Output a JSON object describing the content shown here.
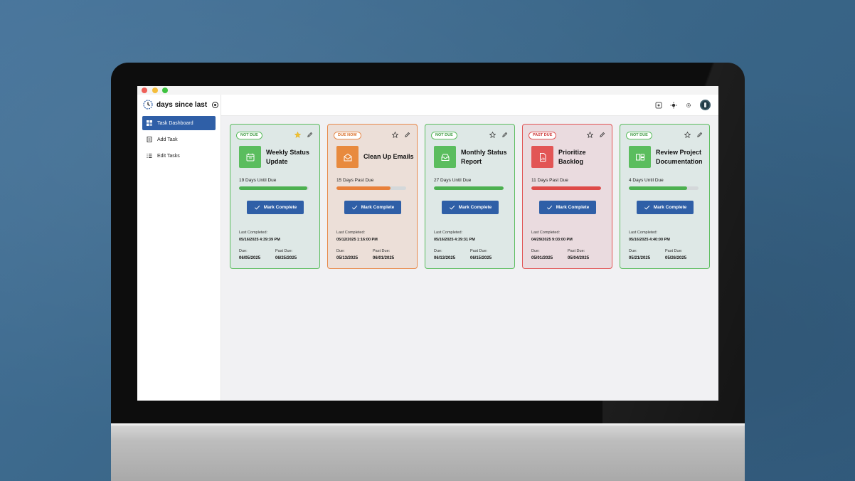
{
  "app": {
    "title": "days since last"
  },
  "sidebar": {
    "items": [
      {
        "label": "Task Dashboard",
        "icon": "dashboard-icon",
        "active": true
      },
      {
        "label": "Add Task",
        "icon": "add-task-icon",
        "active": false
      },
      {
        "label": "Edit Tasks",
        "icon": "list-icon",
        "active": false
      }
    ]
  },
  "topbar": {
    "icons": [
      "grid-icon",
      "sun-icon",
      "settings-icon",
      "avatar"
    ]
  },
  "colors": {
    "primary": "#2f5fa7",
    "not_due": "#5bbd5e",
    "due_now": "#e88a4b",
    "past_due": "#e25555"
  },
  "mark_label": "Mark Complete",
  "labels": {
    "last_completed": "Last Completed:",
    "due": "Due:",
    "past_due": "Past Due:"
  },
  "tasks": [
    {
      "badge": "NOT DUE",
      "status_class": "ok",
      "starred": true,
      "icon": "calendar-icon",
      "title": "Weekly Status Update",
      "status_text": "19 Days Until Due",
      "progress": 0.98,
      "last_completed": "05/16/2025 4:39:39 PM",
      "due": "06/05/2025",
      "past_due": "06/25/2025"
    },
    {
      "badge": "DUE NOW",
      "status_class": "now",
      "starred": false,
      "icon": "envelope-icon",
      "title": "Clean Up Emails",
      "status_text": "15 Days Past Due",
      "progress": 0.78,
      "last_completed": "05/12/2025 1:16:00 PM",
      "due": "05/13/2025",
      "past_due": "06/01/2025"
    },
    {
      "badge": "NOT DUE",
      "status_class": "ok",
      "starred": false,
      "icon": "inbox-icon",
      "title": "Monthly Status Report",
      "status_text": "27 Days Until Due",
      "progress": 1.0,
      "last_completed": "05/16/2025 4:39:31 PM",
      "due": "06/13/2025",
      "past_due": "06/15/2025"
    },
    {
      "badge": "PAST DUE",
      "status_class": "past",
      "starred": false,
      "icon": "report-icon",
      "title": "Prioritize Backlog",
      "status_text": "11 Days Past Due",
      "progress": 1.0,
      "last_completed": "04/29/2025 9:03:00 PM",
      "due": "05/01/2025",
      "past_due": "05/04/2025"
    },
    {
      "badge": "NOT DUE",
      "status_class": "ok",
      "starred": false,
      "icon": "layout-icon",
      "title": "Review Project Documentation",
      "status_text": "4 Days Until Due",
      "progress": 0.84,
      "last_completed": "05/16/2025 4:40:00 PM",
      "due": "05/21/2025",
      "past_due": "05/26/2025"
    }
  ]
}
